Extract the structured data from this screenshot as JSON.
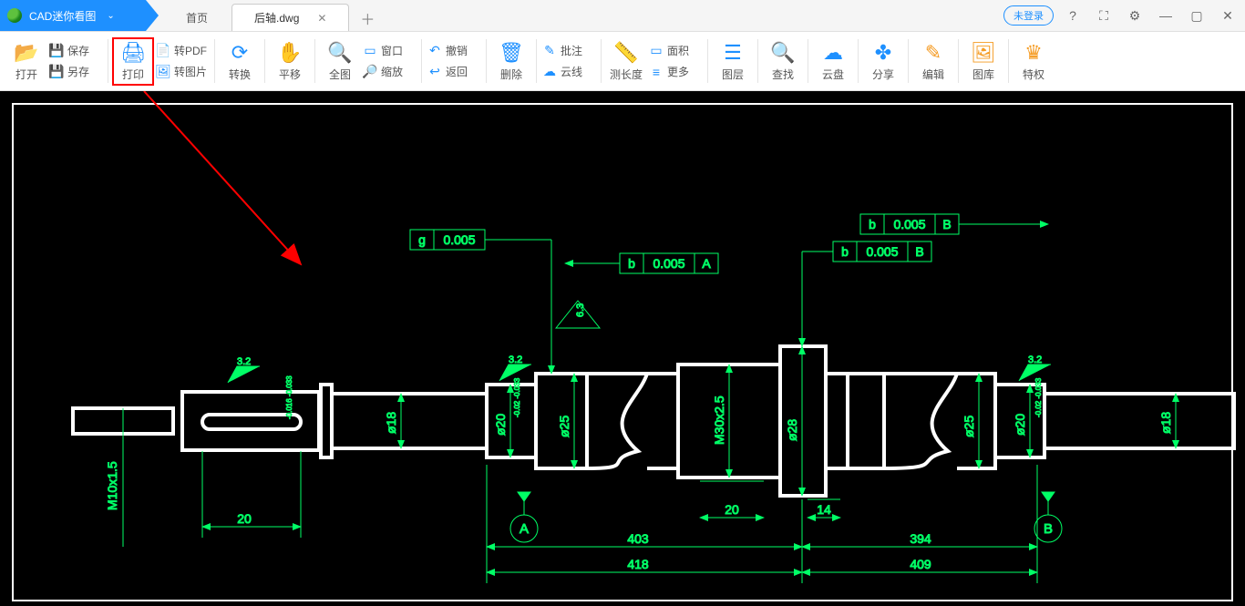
{
  "app": {
    "title": "CAD迷你看图"
  },
  "tabs": {
    "home": "首页",
    "file": "后轴.dwg"
  },
  "titleright": {
    "login": "未登录"
  },
  "toolbar": {
    "open": "打开",
    "save": "保存",
    "saveas": "另存",
    "print": "打印",
    "pdf": "转PDF",
    "img": "转图片",
    "convert": "转换",
    "pan": "平移",
    "fit": "全图",
    "window": "窗口",
    "zoom": "缩放",
    "undo": "撤销",
    "back": "返回",
    "delete": "删除",
    "annotate": "批注",
    "cloud": "云线",
    "measure": "测长度",
    "area": "面积",
    "more": "更多",
    "layer": "图层",
    "find": "查找",
    "clouddisk": "云盘",
    "share": "分享",
    "edit": "编辑",
    "gallery": "图库",
    "vip": "特权"
  },
  "drawing": {
    "tol": {
      "g": "g",
      "b": "b",
      "v": "0.005",
      "A": "A",
      "B": "B"
    },
    "datum": {
      "A": "A",
      "B": "B"
    },
    "dims": {
      "t20a": "20",
      "t20b": "20",
      "t14": "14",
      "l403": "403",
      "l394": "394",
      "l418": "418",
      "l409": "409",
      "m10": "M10x1.5",
      "d18a": "ø18",
      "d18b": "ø18",
      "d20a": "ø20",
      "d20b": "ø20",
      "d25a": "ø25",
      "d25b": "ø25",
      "d28": "ø28",
      "m30": "M30x2.5",
      "tol18": "-0.016\n-0.033",
      "tol20a": "-0.02\n-0.033",
      "tol20b": "-0.02\n-0.033"
    },
    "surf": {
      "v32": "3.2",
      "v63": "6.3"
    }
  }
}
